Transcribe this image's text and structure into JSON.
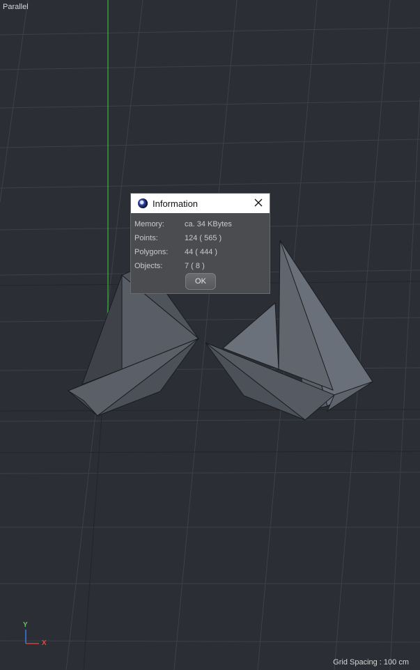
{
  "viewport": {
    "view_mode": "Parallel",
    "grid_spacing_text": "Grid Spacing : 100 cm",
    "axis_labels": {
      "y": "Y",
      "x": "X"
    },
    "colors": {
      "background": "#2b2e34",
      "grid_line": "#3c4047",
      "y_axis": "#3cb83c",
      "model_fill": "#535860"
    }
  },
  "dialog": {
    "title": "Information",
    "icon": "app-logo-icon",
    "rows": [
      {
        "label": "Memory:",
        "value": "ca. 34 KBytes"
      },
      {
        "label": "Points:",
        "value": "124 ( 565 )"
      },
      {
        "label": "Polygons:",
        "value": "44 ( 444 )"
      },
      {
        "label": "Objects:",
        "value": "7 ( 8 )"
      }
    ],
    "ok_label": "OK",
    "close_icon": "close-icon"
  }
}
